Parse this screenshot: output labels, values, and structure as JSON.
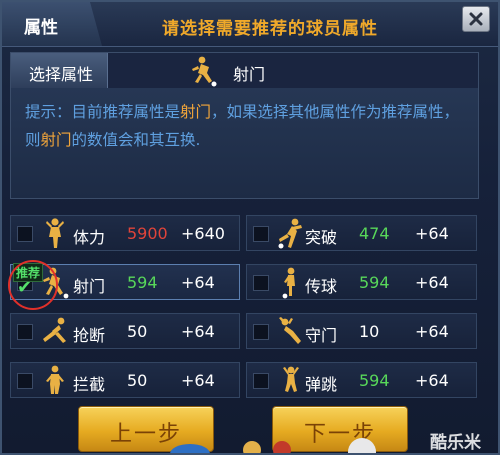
{
  "header": {
    "tab_label": "属性",
    "title": "请选择需要推荐的球员属性",
    "close_icon": "close-icon"
  },
  "select": {
    "label": "选择属性",
    "icon": "shooting-player-icon",
    "value": "射门"
  },
  "hint": {
    "prefix": "提示：目前推荐属性是",
    "attr1": "射门",
    "middle": "，如果选择其他属性作为推荐属性，则",
    "attr2": "射门",
    "suffix": "的数值会和其互换."
  },
  "attributes": [
    {
      "name": "体力",
      "value": "5900",
      "bonus": "+640",
      "value_color": "#e0443a",
      "checked": false,
      "icon": "stamina-player-icon"
    },
    {
      "name": "突破",
      "value": "474",
      "bonus": "+64",
      "value_color": "#58d85a",
      "checked": false,
      "icon": "dribble-player-icon"
    },
    {
      "name": "射门",
      "value": "594",
      "bonus": "+64",
      "value_color": "#58d85a",
      "checked": true,
      "recommended": true,
      "icon": "shooting-player-icon"
    },
    {
      "name": "传球",
      "value": "594",
      "bonus": "+64",
      "value_color": "#58d85a",
      "checked": false,
      "icon": "passing-player-icon"
    },
    {
      "name": "抢断",
      "value": "50",
      "bonus": "+64",
      "value_color": "#ffffff",
      "checked": false,
      "icon": "tackle-player-icon"
    },
    {
      "name": "守门",
      "value": "10",
      "bonus": "+64",
      "value_color": "#ffffff",
      "checked": false,
      "icon": "goalkeeper-player-icon"
    },
    {
      "name": "拦截",
      "value": "50",
      "bonus": "+64",
      "value_color": "#ffffff",
      "checked": false,
      "icon": "intercept-player-icon"
    },
    {
      "name": "弹跳",
      "value": "594",
      "bonus": "+64",
      "value_color": "#58d85a",
      "checked": false,
      "icon": "jump-player-icon"
    }
  ],
  "recommend_badge": "推荐",
  "buttons": {
    "prev": "上一步",
    "next": "下一步"
  },
  "watermark": "酷乐米",
  "colors": {
    "accent_orange": "#f0a92a",
    "hint_blue": "#5fa0e0",
    "green_value": "#58d85a",
    "red_value": "#e0443a",
    "button_gold": "#e6ab21"
  }
}
